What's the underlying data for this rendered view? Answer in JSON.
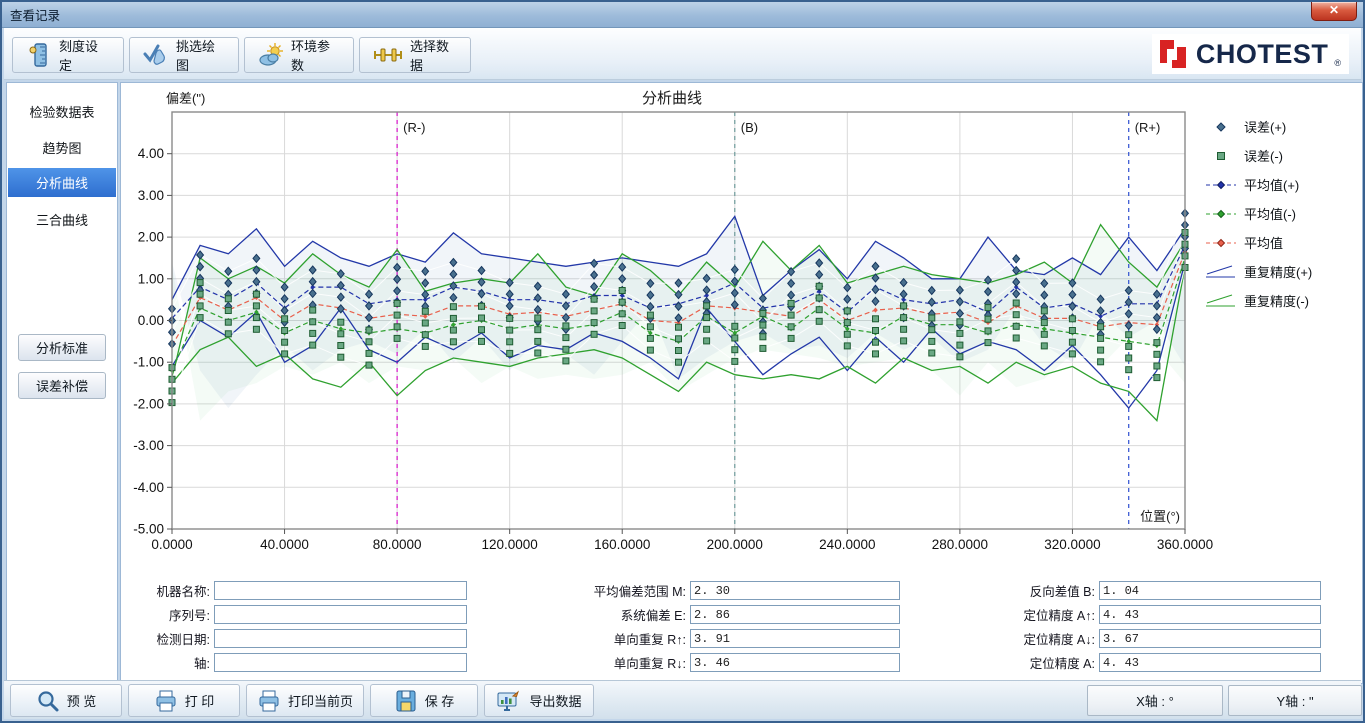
{
  "window": {
    "title": "查看记录",
    "close": "✕"
  },
  "toolbar": {
    "buttons": [
      {
        "label": "刻度设定"
      },
      {
        "label": "挑选绘图"
      },
      {
        "label": "环境参数"
      },
      {
        "label": "选择数据"
      }
    ]
  },
  "brand": {
    "name": "CHOTEST",
    "reg": "®"
  },
  "sidebar": {
    "items": [
      {
        "label": "检验数据表"
      },
      {
        "label": "趋势图"
      },
      {
        "label": "分析曲线"
      },
      {
        "label": "三合曲线"
      }
    ],
    "buttons": [
      {
        "label": "分析标准"
      },
      {
        "label": "误差补偿"
      }
    ]
  },
  "chart_data": {
    "type": "line",
    "title": "分析曲线",
    "ylabel": "偏差(\")",
    "xlabel": "位置(°)",
    "xlim": [
      0,
      360
    ],
    "ylim": [
      -5,
      5
    ],
    "grid": true,
    "legend_position": "right",
    "y_ticks": [
      "4.00",
      "3.00",
      "2.00",
      "1.00",
      "0.00",
      "-1.00",
      "-2.00",
      "-3.00",
      "-4.00",
      "-5.00"
    ],
    "x_ticks": [
      "0.0000",
      "40.0000",
      "80.0000",
      "120.0000",
      "160.0000",
      "200.0000",
      "240.0000",
      "280.0000",
      "320.0000",
      "360.0000"
    ],
    "x": [
      0,
      10,
      20,
      30,
      40,
      50,
      60,
      70,
      80,
      90,
      100,
      110,
      120,
      130,
      140,
      150,
      160,
      170,
      180,
      190,
      200,
      210,
      220,
      230,
      240,
      250,
      260,
      270,
      280,
      290,
      300,
      310,
      320,
      330,
      340,
      350,
      360
    ],
    "vertical_markers": [
      {
        "label": "(R-)",
        "x": 80,
        "color": "#d613c9"
      },
      {
        "label": "(B)",
        "x": 200,
        "color": "#6f9c9c"
      },
      {
        "label": "(R+)",
        "x": 340,
        "color": "#2d50d0"
      }
    ],
    "series": [
      {
        "name": "重复精度(+)",
        "role": "band_upper",
        "color": "#2338a8",
        "fill": "rgba(120,160,200,0.10)",
        "values": [
          0.5,
          1.8,
          1.6,
          2.2,
          1.3,
          1.9,
          1.5,
          1.3,
          1.6,
          1.4,
          2.1,
          1.6,
          1.5,
          1.4,
          1.3,
          1.4,
          1.5,
          1.4,
          1.3,
          1.6,
          2.5,
          0.6,
          1.2,
          1.7,
          1.0,
          1.9,
          1.5,
          1.0,
          1.0,
          2.0,
          1.2,
          1.1,
          1.5,
          1.1,
          2.0,
          1.2,
          2.2
        ]
      },
      {
        "name": "重复精度(+)",
        "role": "band_lower",
        "color": "#2338a8",
        "values": [
          -1.1,
          0.0,
          -0.4,
          0.2,
          -1.0,
          -0.6,
          0.3,
          -0.7,
          -1.0,
          -0.4,
          -0.7,
          -0.3,
          -0.9,
          -0.6,
          -0.7,
          -0.3,
          -0.5,
          -0.9,
          -1.4,
          0.3,
          -0.5,
          -1.3,
          -0.8,
          -0.4,
          -1.2,
          -0.4,
          -1.0,
          -0.2,
          -0.8,
          -0.5,
          -0.7,
          -1.2,
          -0.6,
          -1.3,
          -2.1,
          -1.2,
          1.4
        ]
      },
      {
        "name": "重复精度(-)",
        "role": "band_upper",
        "color": "#2fa12f",
        "fill": "rgba(120,200,140,0.08)",
        "values": [
          -1.4,
          1.5,
          1.0,
          1.3,
          0.9,
          1.6,
          1.1,
          0.8,
          1.7,
          0.7,
          0.9,
          1.0,
          0.9,
          1.6,
          0.8,
          0.6,
          1.6,
          1.2,
          0.6,
          1.4,
          0.8,
          1.9,
          1.2,
          1.8,
          0.9,
          1.1,
          1.3,
          1.1,
          1.0,
          0.9,
          1.1,
          1.4,
          0.9,
          2.3,
          1.4,
          0.8,
          1.9
        ]
      },
      {
        "name": "重复精度(-)",
        "role": "band_lower",
        "color": "#2fa12f",
        "values": [
          -1.5,
          -0.7,
          -0.4,
          -1.1,
          -0.8,
          -1.4,
          -1.6,
          -1.0,
          -1.8,
          -1.2,
          -0.9,
          -1.0,
          -1.1,
          -0.9,
          -0.8,
          -0.7,
          -0.9,
          -1.3,
          -1.7,
          -1.0,
          -1.3,
          -1.4,
          -1.3,
          -1.4,
          -1.1,
          -1.5,
          -0.9,
          -1.2,
          -1.1,
          -1.5,
          -1.0,
          -1.3,
          -1.1,
          -1.5,
          -1.7,
          -2.4,
          1.3
        ]
      },
      {
        "name": "平均值(+)",
        "role": "dashed",
        "color": "#2233aa",
        "values": [
          0.05,
          0.8,
          0.5,
          0.9,
          0.3,
          0.8,
          0.8,
          0.4,
          0.5,
          0.5,
          0.8,
          0.7,
          0.5,
          0.5,
          0.4,
          0.6,
          0.6,
          0.3,
          0.4,
          0.6,
          0.9,
          0.3,
          0.4,
          0.7,
          0.2,
          0.8,
          0.5,
          0.4,
          0.5,
          0.2,
          0.8,
          0.3,
          0.4,
          0.1,
          0.4,
          0.4,
          1.8
        ]
      },
      {
        "name": "平均值(-)",
        "role": "dashed",
        "color": "#2fa12f",
        "values": [
          -1.2,
          0.3,
          0.0,
          0.2,
          -0.3,
          0.0,
          -0.2,
          -0.3,
          -0.2,
          -0.3,
          -0.1,
          0.0,
          -0.2,
          -0.1,
          -0.2,
          -0.1,
          0.2,
          -0.3,
          -0.5,
          0.1,
          -0.3,
          0.1,
          -0.2,
          0.3,
          -0.2,
          -0.3,
          0.1,
          -0.1,
          -0.1,
          -0.3,
          -0.1,
          -0.2,
          -0.3,
          -0.4,
          -0.5,
          -0.6,
          1.5
        ]
      },
      {
        "name": "平均值",
        "role": "dashed",
        "color": "#e8604c",
        "values": [
          -0.6,
          0.55,
          0.25,
          0.55,
          0.0,
          0.4,
          0.3,
          0.05,
          0.15,
          0.1,
          0.35,
          0.35,
          0.15,
          0.2,
          0.1,
          0.25,
          0.4,
          0.0,
          -0.05,
          0.35,
          0.3,
          0.2,
          0.1,
          0.5,
          0.0,
          0.25,
          0.3,
          0.15,
          0.2,
          -0.05,
          0.35,
          0.05,
          0.05,
          -0.15,
          -0.05,
          -0.1,
          1.65
        ]
      }
    ],
    "scatter": [
      {
        "name": "误差(+)",
        "marker": "diamond",
        "fill": "#49708e",
        "stroke": "#17375e",
        "base_index": 4,
        "offsets": [
          0.5,
          0.22,
          -0.06,
          -0.34
        ]
      },
      {
        "name": "误差(-)",
        "marker": "square",
        "fill": "#6aa884",
        "stroke": "#1e5c32",
        "base_index": 5,
        "offsets": [
          0.34,
          0.06,
          -0.22,
          -0.5
        ]
      }
    ],
    "legend": [
      {
        "label": "误差(+)"
      },
      {
        "label": "误差(-)"
      },
      {
        "label": "平均值(+)"
      },
      {
        "label": "平均值(-)"
      },
      {
        "label": "平均值"
      },
      {
        "label": "重复精度(+)"
      },
      {
        "label": "重复精度(-)"
      }
    ]
  },
  "form": {
    "left": [
      {
        "label": "机器名称:",
        "value": ""
      },
      {
        "label": "序列号:",
        "value": ""
      },
      {
        "label": "检测日期:",
        "value": ""
      },
      {
        "label": "轴:",
        "value": ""
      }
    ],
    "mid": [
      {
        "label": "平均偏差范围 M:",
        "value": "2. 30"
      },
      {
        "label": "系统偏差 E:",
        "value": "2. 86"
      },
      {
        "label": "单向重复 R↑:",
        "value": "3. 91"
      },
      {
        "label": "单向重复 R↓:",
        "value": "3. 46"
      }
    ],
    "right": [
      {
        "label": "反向差值 B:",
        "value": "1. 04"
      },
      {
        "label": "定位精度 A↑:",
        "value": "4. 43"
      },
      {
        "label": "定位精度 A↓:",
        "value": "3. 67"
      },
      {
        "label": "定位精度 A:",
        "value": "4. 43"
      }
    ]
  },
  "bottom_toolbar": {
    "buttons": [
      {
        "label": "预 览"
      },
      {
        "label": "打 印"
      },
      {
        "label": "打印当前页"
      },
      {
        "label": "保 存"
      },
      {
        "label": "导出数据"
      }
    ],
    "axis_buttons": [
      {
        "label": "X轴 : °"
      },
      {
        "label": "Y轴 : \""
      }
    ]
  }
}
